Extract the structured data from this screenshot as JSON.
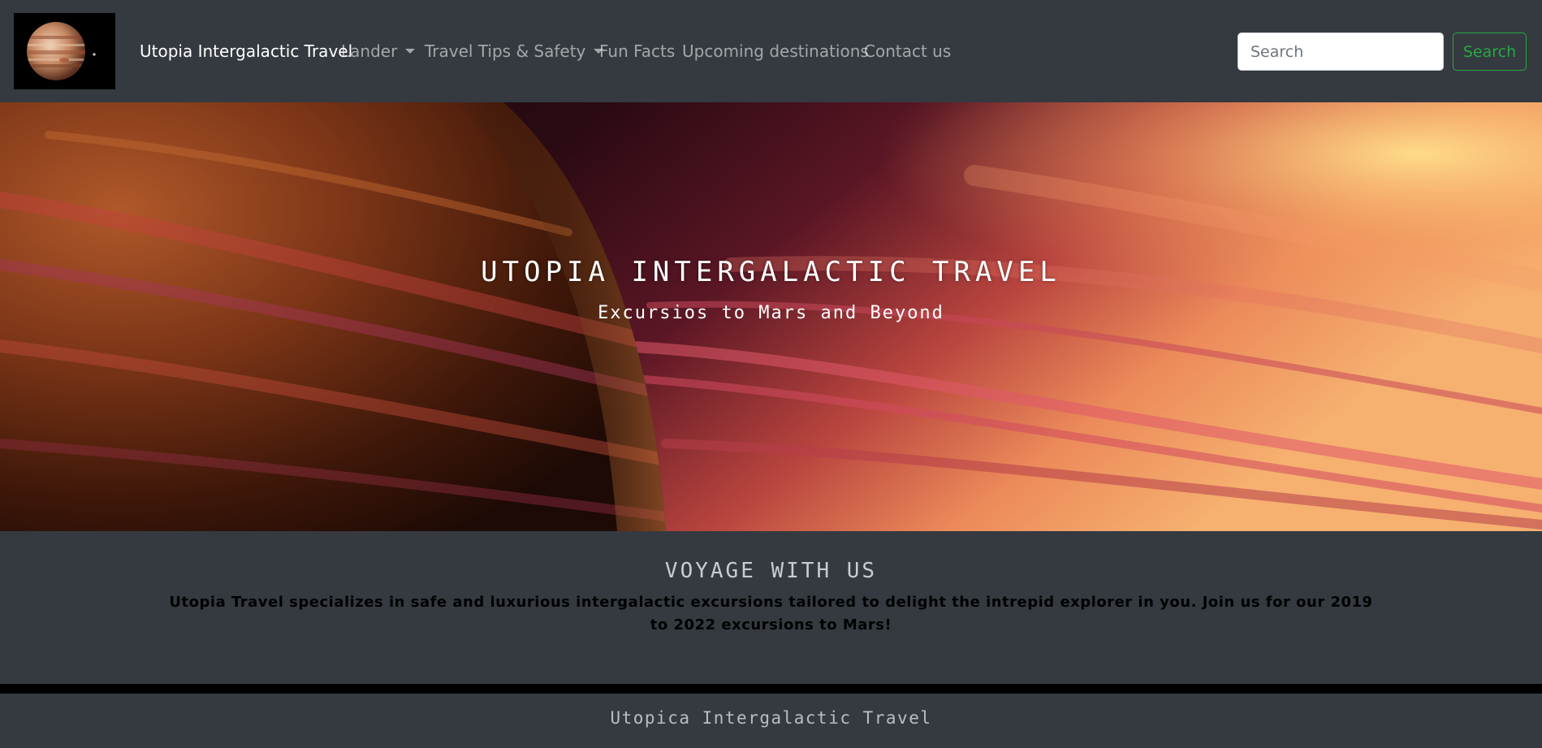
{
  "navbar": {
    "logo_icon": "planet-jupiter-icon",
    "brand": "Utopia Intergalactic Travel",
    "items": [
      {
        "label": "Lander",
        "dropdown": true
      },
      {
        "label": "Travel Tips & Safety",
        "dropdown": true
      },
      {
        "label": "Fun Facts",
        "dropdown": false
      },
      {
        "label": "Upcoming destinations",
        "dropdown": false
      },
      {
        "label": "Contact us",
        "dropdown": false
      }
    ],
    "search": {
      "placeholder": "Search",
      "value": "",
      "button_label": "Search"
    }
  },
  "hero": {
    "title": "UTOPIA INTERGALACTIC TRAVEL",
    "subtitle": "Excursios to Mars and Beyond"
  },
  "about": {
    "heading": "VOYAGE WITH US",
    "text": "Utopia Travel specializes in safe and luxurious intergalactic excursions tailored to delight the intrepid explorer in you. Join us for our 2019 to 2022 excursions to Mars!"
  },
  "footer": {
    "text": "Utopica Intergalactic Travel"
  },
  "colors": {
    "navbar_bg": "#343a40",
    "nav_link": "rgba(255,255,255,0.55)",
    "brand": "#ffffff",
    "search_accent": "#28a745",
    "about_heading": "#c9ccd0",
    "about_text": "#000000",
    "footer_text": "#b9bdc1"
  }
}
